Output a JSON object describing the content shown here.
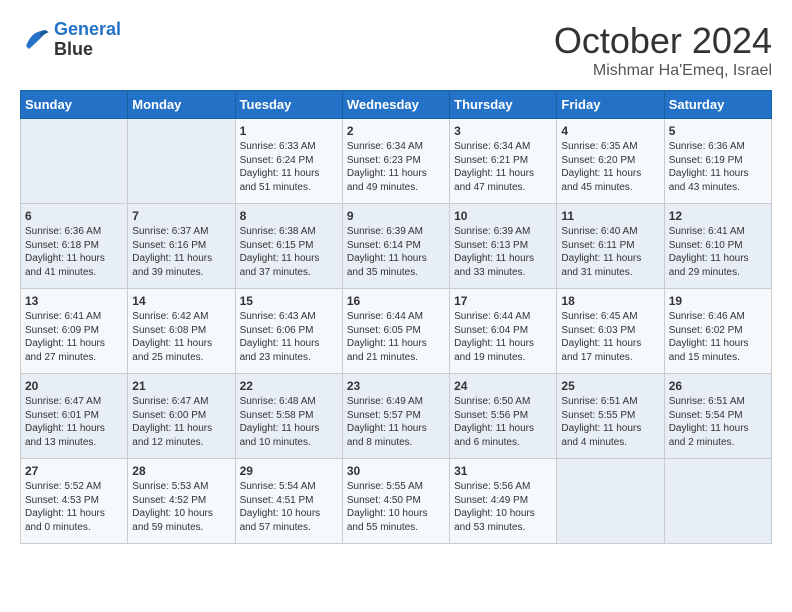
{
  "logo": {
    "line1": "General",
    "line2": "Blue"
  },
  "header": {
    "month": "October 2024",
    "location": "Mishmar Ha'Emeq, Israel"
  },
  "days_of_week": [
    "Sunday",
    "Monday",
    "Tuesday",
    "Wednesday",
    "Thursday",
    "Friday",
    "Saturday"
  ],
  "weeks": [
    [
      {
        "day": "",
        "sunrise": "",
        "sunset": "",
        "daylight": ""
      },
      {
        "day": "",
        "sunrise": "",
        "sunset": "",
        "daylight": ""
      },
      {
        "day": "1",
        "sunrise": "Sunrise: 6:33 AM",
        "sunset": "Sunset: 6:24 PM",
        "daylight": "Daylight: 11 hours and 51 minutes."
      },
      {
        "day": "2",
        "sunrise": "Sunrise: 6:34 AM",
        "sunset": "Sunset: 6:23 PM",
        "daylight": "Daylight: 11 hours and 49 minutes."
      },
      {
        "day": "3",
        "sunrise": "Sunrise: 6:34 AM",
        "sunset": "Sunset: 6:21 PM",
        "daylight": "Daylight: 11 hours and 47 minutes."
      },
      {
        "day": "4",
        "sunrise": "Sunrise: 6:35 AM",
        "sunset": "Sunset: 6:20 PM",
        "daylight": "Daylight: 11 hours and 45 minutes."
      },
      {
        "day": "5",
        "sunrise": "Sunrise: 6:36 AM",
        "sunset": "Sunset: 6:19 PM",
        "daylight": "Daylight: 11 hours and 43 minutes."
      }
    ],
    [
      {
        "day": "6",
        "sunrise": "Sunrise: 6:36 AM",
        "sunset": "Sunset: 6:18 PM",
        "daylight": "Daylight: 11 hours and 41 minutes."
      },
      {
        "day": "7",
        "sunrise": "Sunrise: 6:37 AM",
        "sunset": "Sunset: 6:16 PM",
        "daylight": "Daylight: 11 hours and 39 minutes."
      },
      {
        "day": "8",
        "sunrise": "Sunrise: 6:38 AM",
        "sunset": "Sunset: 6:15 PM",
        "daylight": "Daylight: 11 hours and 37 minutes."
      },
      {
        "day": "9",
        "sunrise": "Sunrise: 6:39 AM",
        "sunset": "Sunset: 6:14 PM",
        "daylight": "Daylight: 11 hours and 35 minutes."
      },
      {
        "day": "10",
        "sunrise": "Sunrise: 6:39 AM",
        "sunset": "Sunset: 6:13 PM",
        "daylight": "Daylight: 11 hours and 33 minutes."
      },
      {
        "day": "11",
        "sunrise": "Sunrise: 6:40 AM",
        "sunset": "Sunset: 6:11 PM",
        "daylight": "Daylight: 11 hours and 31 minutes."
      },
      {
        "day": "12",
        "sunrise": "Sunrise: 6:41 AM",
        "sunset": "Sunset: 6:10 PM",
        "daylight": "Daylight: 11 hours and 29 minutes."
      }
    ],
    [
      {
        "day": "13",
        "sunrise": "Sunrise: 6:41 AM",
        "sunset": "Sunset: 6:09 PM",
        "daylight": "Daylight: 11 hours and 27 minutes."
      },
      {
        "day": "14",
        "sunrise": "Sunrise: 6:42 AM",
        "sunset": "Sunset: 6:08 PM",
        "daylight": "Daylight: 11 hours and 25 minutes."
      },
      {
        "day": "15",
        "sunrise": "Sunrise: 6:43 AM",
        "sunset": "Sunset: 6:06 PM",
        "daylight": "Daylight: 11 hours and 23 minutes."
      },
      {
        "day": "16",
        "sunrise": "Sunrise: 6:44 AM",
        "sunset": "Sunset: 6:05 PM",
        "daylight": "Daylight: 11 hours and 21 minutes."
      },
      {
        "day": "17",
        "sunrise": "Sunrise: 6:44 AM",
        "sunset": "Sunset: 6:04 PM",
        "daylight": "Daylight: 11 hours and 19 minutes."
      },
      {
        "day": "18",
        "sunrise": "Sunrise: 6:45 AM",
        "sunset": "Sunset: 6:03 PM",
        "daylight": "Daylight: 11 hours and 17 minutes."
      },
      {
        "day": "19",
        "sunrise": "Sunrise: 6:46 AM",
        "sunset": "Sunset: 6:02 PM",
        "daylight": "Daylight: 11 hours and 15 minutes."
      }
    ],
    [
      {
        "day": "20",
        "sunrise": "Sunrise: 6:47 AM",
        "sunset": "Sunset: 6:01 PM",
        "daylight": "Daylight: 11 hours and 13 minutes."
      },
      {
        "day": "21",
        "sunrise": "Sunrise: 6:47 AM",
        "sunset": "Sunset: 6:00 PM",
        "daylight": "Daylight: 11 hours and 12 minutes."
      },
      {
        "day": "22",
        "sunrise": "Sunrise: 6:48 AM",
        "sunset": "Sunset: 5:58 PM",
        "daylight": "Daylight: 11 hours and 10 minutes."
      },
      {
        "day": "23",
        "sunrise": "Sunrise: 6:49 AM",
        "sunset": "Sunset: 5:57 PM",
        "daylight": "Daylight: 11 hours and 8 minutes."
      },
      {
        "day": "24",
        "sunrise": "Sunrise: 6:50 AM",
        "sunset": "Sunset: 5:56 PM",
        "daylight": "Daylight: 11 hours and 6 minutes."
      },
      {
        "day": "25",
        "sunrise": "Sunrise: 6:51 AM",
        "sunset": "Sunset: 5:55 PM",
        "daylight": "Daylight: 11 hours and 4 minutes."
      },
      {
        "day": "26",
        "sunrise": "Sunrise: 6:51 AM",
        "sunset": "Sunset: 5:54 PM",
        "daylight": "Daylight: 11 hours and 2 minutes."
      }
    ],
    [
      {
        "day": "27",
        "sunrise": "Sunrise: 5:52 AM",
        "sunset": "Sunset: 4:53 PM",
        "daylight": "Daylight: 11 hours and 0 minutes."
      },
      {
        "day": "28",
        "sunrise": "Sunrise: 5:53 AM",
        "sunset": "Sunset: 4:52 PM",
        "daylight": "Daylight: 10 hours and 59 minutes."
      },
      {
        "day": "29",
        "sunrise": "Sunrise: 5:54 AM",
        "sunset": "Sunset: 4:51 PM",
        "daylight": "Daylight: 10 hours and 57 minutes."
      },
      {
        "day": "30",
        "sunrise": "Sunrise: 5:55 AM",
        "sunset": "Sunset: 4:50 PM",
        "daylight": "Daylight: 10 hours and 55 minutes."
      },
      {
        "day": "31",
        "sunrise": "Sunrise: 5:56 AM",
        "sunset": "Sunset: 4:49 PM",
        "daylight": "Daylight: 10 hours and 53 minutes."
      },
      {
        "day": "",
        "sunrise": "",
        "sunset": "",
        "daylight": ""
      },
      {
        "day": "",
        "sunrise": "",
        "sunset": "",
        "daylight": ""
      }
    ]
  ]
}
